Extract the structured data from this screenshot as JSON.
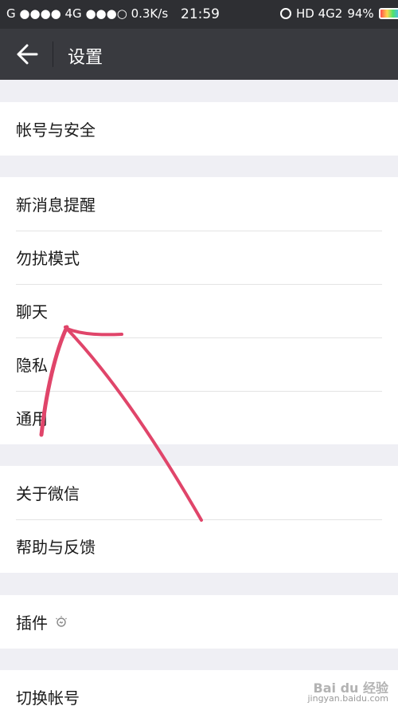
{
  "status_bar": {
    "carrier": "G ●●●● 4G ●●●○ 0.3K/s",
    "time": "21:59",
    "network": "HD 4G2",
    "battery": "94%",
    "battery_level": 0.94
  },
  "nav": {
    "title": "设置"
  },
  "groups": [
    {
      "items": [
        "帐号与安全"
      ]
    },
    {
      "items": [
        "新消息提醒",
        "勿扰模式",
        "聊天",
        "隐私",
        "通用"
      ]
    },
    {
      "items": [
        "关于微信",
        "帮助与反馈"
      ]
    },
    {
      "items": [
        "插件"
      ]
    },
    {
      "items": [
        "切换帐号"
      ]
    }
  ],
  "watermark": {
    "brand": "Bai du 经验",
    "url": "jingyan.baidu.com"
  },
  "colors": {
    "nav_bg": "#393a3f",
    "status_bg": "#2e2f33",
    "page_bg": "#efeff4",
    "annotation": "#e0456a"
  }
}
